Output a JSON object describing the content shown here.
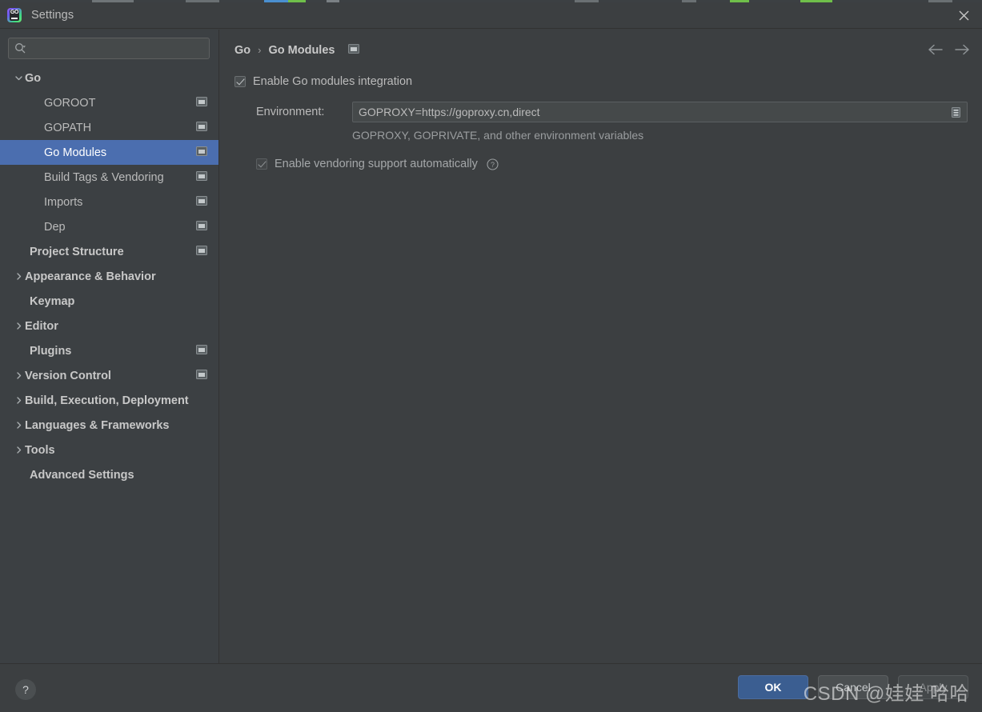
{
  "window": {
    "title": "Settings",
    "logo_icon": "goland-logo-icon",
    "close_icon": "close-icon"
  },
  "search": {
    "value": "",
    "placeholder": "",
    "icon": "search-icon"
  },
  "sidebar": {
    "items": [
      {
        "label": "Go",
        "level": 0,
        "arrow": "chevron-down",
        "bold": true,
        "scope_icon": false,
        "selected": false
      },
      {
        "label": "GOROOT",
        "level": 1,
        "arrow": "none",
        "bold": false,
        "scope_icon": true,
        "selected": false
      },
      {
        "label": "GOPATH",
        "level": 1,
        "arrow": "none",
        "bold": false,
        "scope_icon": true,
        "selected": false
      },
      {
        "label": "Go Modules",
        "level": 1,
        "arrow": "none",
        "bold": false,
        "scope_icon": true,
        "selected": true
      },
      {
        "label": "Build Tags & Vendoring",
        "level": 1,
        "arrow": "none",
        "bold": false,
        "scope_icon": true,
        "selected": false
      },
      {
        "label": "Imports",
        "level": 1,
        "arrow": "none",
        "bold": false,
        "scope_icon": true,
        "selected": false
      },
      {
        "label": "Dep",
        "level": 1,
        "arrow": "none",
        "bold": false,
        "scope_icon": true,
        "selected": false
      },
      {
        "label": "Project Structure",
        "level": 0,
        "arrow": "none",
        "bold": true,
        "scope_icon": true,
        "selected": false
      },
      {
        "label": "Appearance & Behavior",
        "level": 0,
        "arrow": "chevron-right",
        "bold": true,
        "scope_icon": false,
        "selected": false
      },
      {
        "label": "Keymap",
        "level": 0,
        "arrow": "none",
        "bold": true,
        "scope_icon": false,
        "selected": false
      },
      {
        "label": "Editor",
        "level": 0,
        "arrow": "chevron-right",
        "bold": true,
        "scope_icon": false,
        "selected": false
      },
      {
        "label": "Plugins",
        "level": 0,
        "arrow": "none",
        "bold": true,
        "scope_icon": true,
        "selected": false
      },
      {
        "label": "Version Control",
        "level": 0,
        "arrow": "chevron-right",
        "bold": true,
        "scope_icon": true,
        "selected": false
      },
      {
        "label": "Build, Execution, Deployment",
        "level": 0,
        "arrow": "chevron-right",
        "bold": true,
        "scope_icon": false,
        "selected": false
      },
      {
        "label": "Languages & Frameworks",
        "level": 0,
        "arrow": "chevron-right",
        "bold": true,
        "scope_icon": false,
        "selected": false
      },
      {
        "label": "Tools",
        "level": 0,
        "arrow": "chevron-right",
        "bold": true,
        "scope_icon": false,
        "selected": false
      },
      {
        "label": "Advanced Settings",
        "level": 0,
        "arrow": "none",
        "bold": true,
        "scope_icon": false,
        "selected": false
      }
    ]
  },
  "content": {
    "breadcrumb": {
      "root": "Go",
      "separator": "›",
      "current": "Go Modules",
      "scope_icon": "project-scope-icon"
    },
    "nav": {
      "back_icon": "arrow-left-icon",
      "forward_icon": "arrow-right-icon"
    },
    "enable_modules": {
      "label": "Enable Go modules integration",
      "checked": true
    },
    "environment": {
      "label": "Environment:",
      "value": "GOPROXY=https://goproxy.cn,direct",
      "placeholder": "",
      "browse_icon": "expand-editor-icon",
      "hint": "GOPROXY, GOPRIVATE, and other environment variables"
    },
    "vendoring": {
      "label": "Enable vendoring support automatically",
      "checked": true,
      "disabled": true,
      "help_icon": "help-circle-icon"
    }
  },
  "footer": {
    "help_icon": "help-icon",
    "help_label": "?",
    "buttons": [
      {
        "label": "OK",
        "style": "primary",
        "name": "ok-button"
      },
      {
        "label": "Cancel",
        "style": "normal",
        "name": "cancel-button"
      },
      {
        "label": "Apply",
        "style": "disabled",
        "name": "apply-button"
      }
    ]
  },
  "watermark": {
    "text": "CSDN @娃娃 哈哈"
  },
  "colors": {
    "panel_bg": "#3c3f41",
    "sidebar_bg": "#3c4043",
    "selection": "#4b6eaf",
    "primary_button": "#3b5e91",
    "text": "#bbbbbb",
    "text_dim": "#9a9d9f",
    "field_bg": "#45494a",
    "border": "#5b5f61"
  }
}
